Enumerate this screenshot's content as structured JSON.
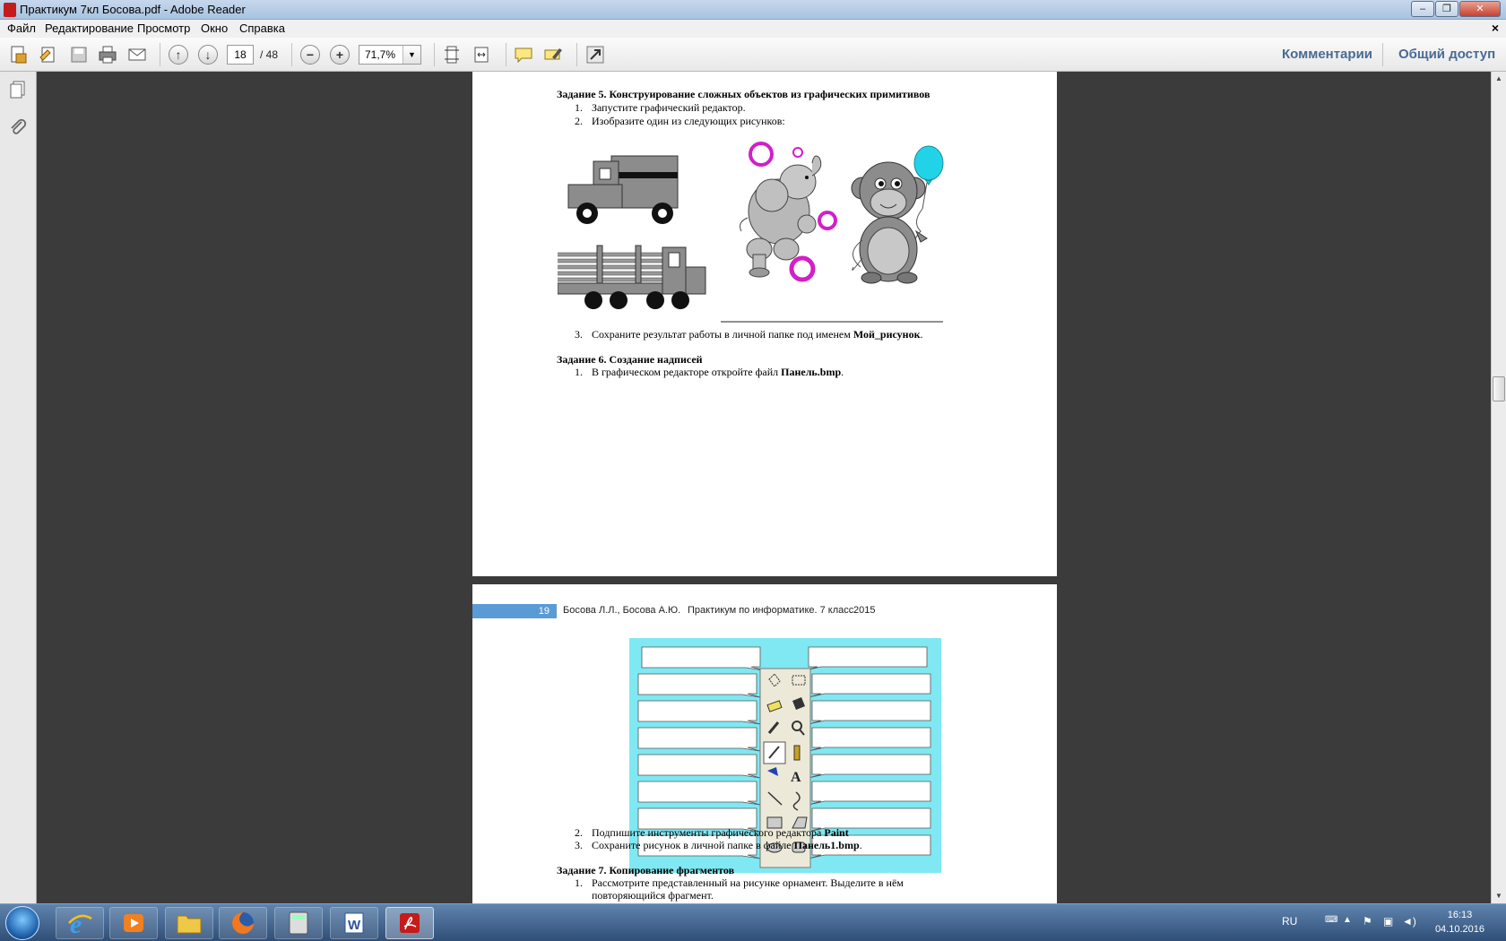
{
  "window": {
    "title": "Практикум 7кл Босова.pdf - Adobe Reader",
    "minimize": "–",
    "maximize": "❐",
    "close": "✕"
  },
  "menu": {
    "items": [
      "Файл",
      "Редактирование",
      "Просмотр",
      "Окно",
      "Справка"
    ],
    "doc_close": "×"
  },
  "toolbar": {
    "current_page": "18",
    "total_pages": "/ 48",
    "zoom": "71,7%",
    "comments": "Комментарии",
    "share": "Общий доступ"
  },
  "page18": {
    "task5_title": "Задание 5. Конструирование сложных объектов из графических примитивов",
    "task5_step1_num": "1.",
    "task5_step1": "Запустите графический редактор.",
    "task5_step2_num": "2.",
    "task5_step2": "Изобразите один из следующих рисунков:",
    "task5_step3_num": "3.",
    "task5_step3_a": "Сохраните результат работы в личной папке под именем ",
    "task5_step3_b": "Мой_рисунок",
    "task5_step3_c": ".",
    "task6_title": "Задание 6. Создание надписей",
    "task6_step1_num": "1.",
    "task6_step1_a": "В графическом редакторе откройте файл ",
    "task6_step1_b": "Панель.bmp",
    "task6_step1_c": "."
  },
  "page19": {
    "page_number": "19",
    "authors": "Босова Л.Л., Босова А.Ю.",
    "book": "Практикум по информатике. 7 класс.",
    "year": "2015",
    "step2_num": "2.",
    "step2_a": "Подпишите инструменты графического редактора ",
    "step2_b": "Paint",
    "step3_num": "3.",
    "step3_a": "Сохраните рисунок в личной папке в файле ",
    "step3_b": "Панель1.bmp",
    "step3_c": ".",
    "task7_title": "Задание 7. Копирование фрагментов",
    "task7_step1_num": "1.",
    "task7_step1_line1": "Рассмотрите   представленный   на   рисунке   орнамент.   Выделите   в   нём",
    "task7_step1_line2": "повторяющийся фрагмент."
  },
  "taskbar": {
    "lang": "RU",
    "time": "16:13",
    "date": "04.10.2016"
  },
  "colors": {
    "paint_panel_bg": "#7fe8f2",
    "pink": "#d21fc8",
    "cyan_balloon": "#22d3e8",
    "page_number_bar": "#5b9bd5",
    "link": "#4a6a92"
  }
}
